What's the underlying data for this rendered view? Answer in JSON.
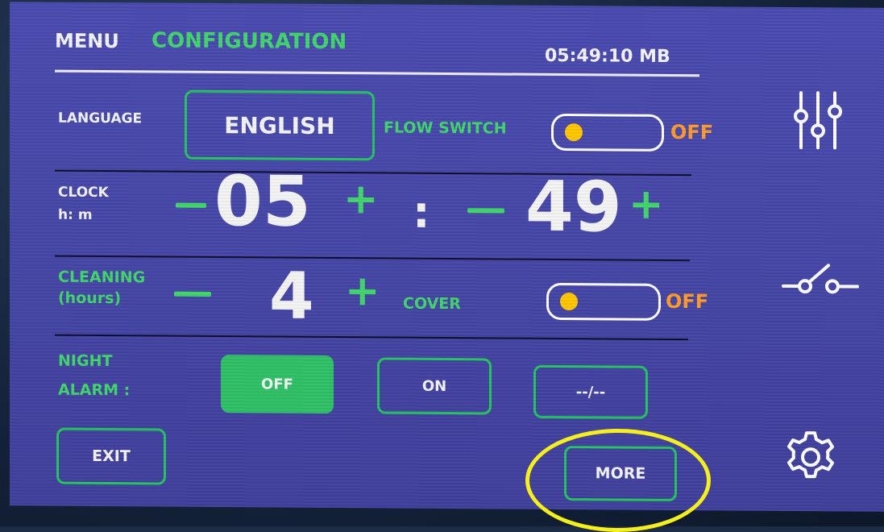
{
  "header": {
    "menu_label": "MENU",
    "title": "CONFIGURATION",
    "time": "05:49:10 MB"
  },
  "language": {
    "label": "LANGUAGE",
    "value": "ENGLISH"
  },
  "flow_switch": {
    "label": "FLOW SWITCH",
    "state": "OFF"
  },
  "clock": {
    "label_line1": "CLOCK",
    "label_line2": "h: m",
    "hours": "05",
    "separator": ":",
    "minutes": "49",
    "plus": "+"
  },
  "cleaning": {
    "label_line1": "CLEANING",
    "label_line2": "(hours)",
    "value": "4",
    "plus": "+"
  },
  "cover": {
    "label": "COVER",
    "state": "OFF"
  },
  "night_alarm": {
    "label_line1": "NIGHT",
    "label_line2": "ALARM :",
    "options": [
      "OFF",
      "ON",
      "--/--"
    ],
    "selected": "OFF"
  },
  "footer": {
    "exit_label": "EXIT",
    "more_label": "MORE"
  },
  "colors": {
    "screen_bg": "#4646a8",
    "accent_green": "#3fd66a",
    "toggle_off_text": "#ff9a2a",
    "knob": "#ffc700",
    "highlight_circle": "#f5ef1a"
  },
  "icons": [
    "sliders-icon",
    "switch-icon",
    "gear-icon"
  ]
}
